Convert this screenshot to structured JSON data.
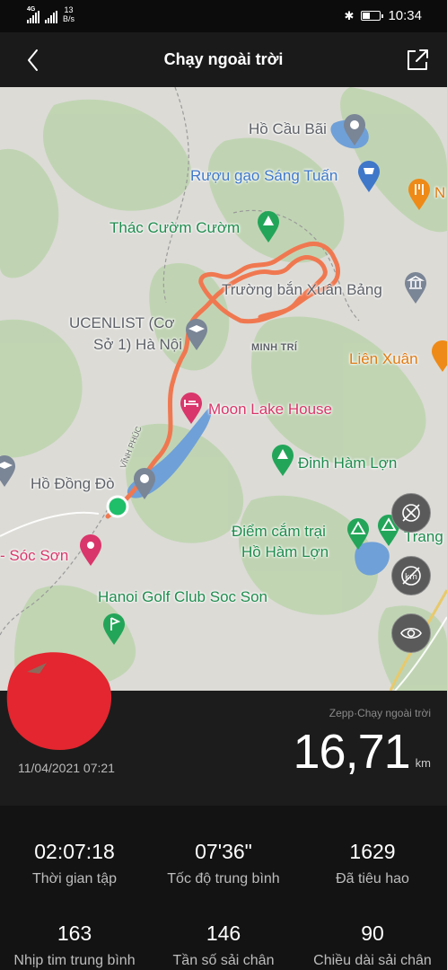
{
  "status_bar": {
    "network_label": "4G",
    "speed_value": "13",
    "speed_unit": "B/s",
    "time": "10:34"
  },
  "header": {
    "title": "Chạy ngoài trời"
  },
  "map": {
    "places": [
      {
        "name": "Hồ Cầu Bãi"
      },
      {
        "name": "Rượu gạo Sáng Tuấn"
      },
      {
        "name": "N"
      },
      {
        "name": "Thác Cườm Cườm"
      },
      {
        "name": "Trường bắn Xuân Bảng"
      },
      {
        "name": "UCENLIST (Cơ"
      },
      {
        "name": "Sở 1) Hà Nội"
      },
      {
        "name": "MINH TRÍ"
      },
      {
        "name": "Liên Xuân"
      },
      {
        "name": "Moon Lake House"
      },
      {
        "name": "Đinh Hàm Lợn"
      },
      {
        "name": "Hồ Đồng Đò"
      },
      {
        "name": "Điểm cắm trại"
      },
      {
        "name": "Hồ Hàm Lợn"
      },
      {
        "name": "Trang"
      },
      {
        "name": "- Sóc Sơn"
      },
      {
        "name": "Hanoi Golf Club Soc Son"
      },
      {
        "name": "VĨNH PHÚC"
      }
    ],
    "route_color": "#f07850",
    "start_marker_color": "#1fbf6a"
  },
  "activity": {
    "date": "11/04/2021 07:21",
    "source": "Zepp·Chạy ngoài trời",
    "distance": "16,71",
    "distance_unit": "km"
  },
  "stats": [
    {
      "value": "02:07:18",
      "label": "Thời gian tập"
    },
    {
      "value": "07'36\"",
      "label": "Tốc độ trung bình"
    },
    {
      "value": "1629",
      "label": "Đã tiêu hao"
    },
    {
      "value": "163",
      "label": "Nhịp tim trung bình"
    },
    {
      "value": "146",
      "label": "Tần số sải chân"
    },
    {
      "value": "90",
      "label": "Chiều dài sải chân"
    }
  ]
}
